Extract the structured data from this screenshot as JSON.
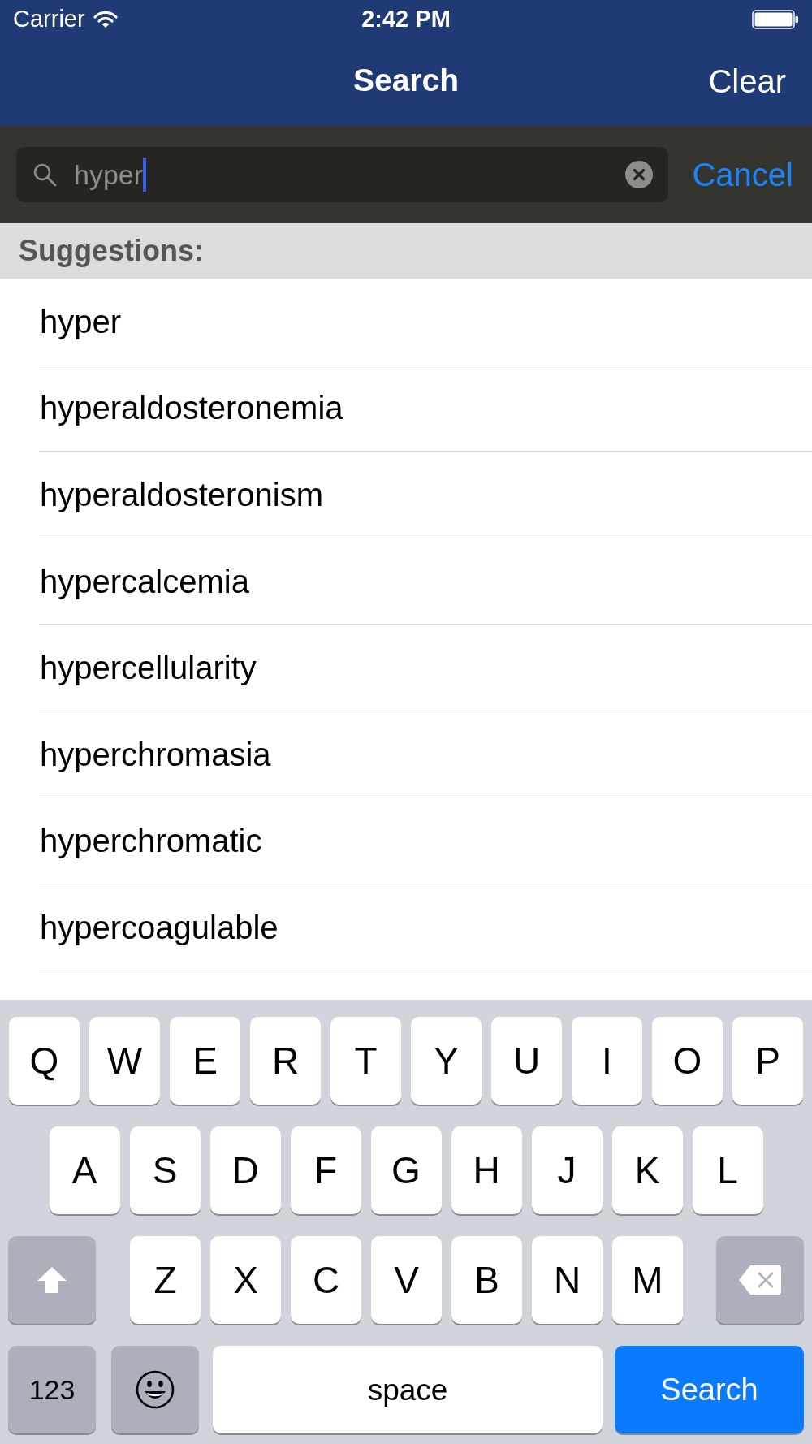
{
  "status_bar": {
    "carrier": "Carrier",
    "time": "2:42 PM"
  },
  "nav_bar": {
    "title": "Search",
    "right_button": "Clear"
  },
  "search_bar": {
    "value": "hyper",
    "cancel_button": "Cancel"
  },
  "suggestions": {
    "header": "Suggestions:",
    "items": [
      "hyper",
      "hyperaldosteronemia",
      "hyperaldosteronism",
      "hypercalcemia",
      "hypercellularity",
      "hyperchromasia",
      "hyperchromatic",
      "hypercoagulable"
    ]
  },
  "keyboard": {
    "rows": [
      {
        "keys": [
          {
            "kind": "letter",
            "label": "Q"
          },
          {
            "kind": "letter",
            "label": "W"
          },
          {
            "kind": "letter",
            "label": "E"
          },
          {
            "kind": "letter",
            "label": "R"
          },
          {
            "kind": "letter",
            "label": "T"
          },
          {
            "kind": "letter",
            "label": "Y"
          },
          {
            "kind": "letter",
            "label": "U"
          },
          {
            "kind": "letter",
            "label": "I"
          },
          {
            "kind": "letter",
            "label": "O"
          },
          {
            "kind": "letter",
            "label": "P"
          }
        ]
      },
      {
        "keys": [
          {
            "kind": "letter",
            "label": "A"
          },
          {
            "kind": "letter",
            "label": "S"
          },
          {
            "kind": "letter",
            "label": "D"
          },
          {
            "kind": "letter",
            "label": "F"
          },
          {
            "kind": "letter",
            "label": "G"
          },
          {
            "kind": "letter",
            "label": "H"
          },
          {
            "kind": "letter",
            "label": "J"
          },
          {
            "kind": "letter",
            "label": "K"
          },
          {
            "kind": "letter",
            "label": "L"
          }
        ]
      },
      {
        "keys": [
          {
            "kind": "shift"
          },
          {
            "kind": "letter",
            "label": "Z"
          },
          {
            "kind": "letter",
            "label": "X"
          },
          {
            "kind": "letter",
            "label": "C"
          },
          {
            "kind": "letter",
            "label": "V"
          },
          {
            "kind": "letter",
            "label": "B"
          },
          {
            "kind": "letter",
            "label": "N"
          },
          {
            "kind": "letter",
            "label": "M"
          },
          {
            "kind": "delete"
          }
        ]
      },
      {
        "keys": [
          {
            "kind": "mode",
            "label": "123"
          },
          {
            "kind": "emoji"
          },
          {
            "kind": "space",
            "label": "space"
          },
          {
            "kind": "action",
            "label": "Search"
          }
        ]
      }
    ]
  }
}
